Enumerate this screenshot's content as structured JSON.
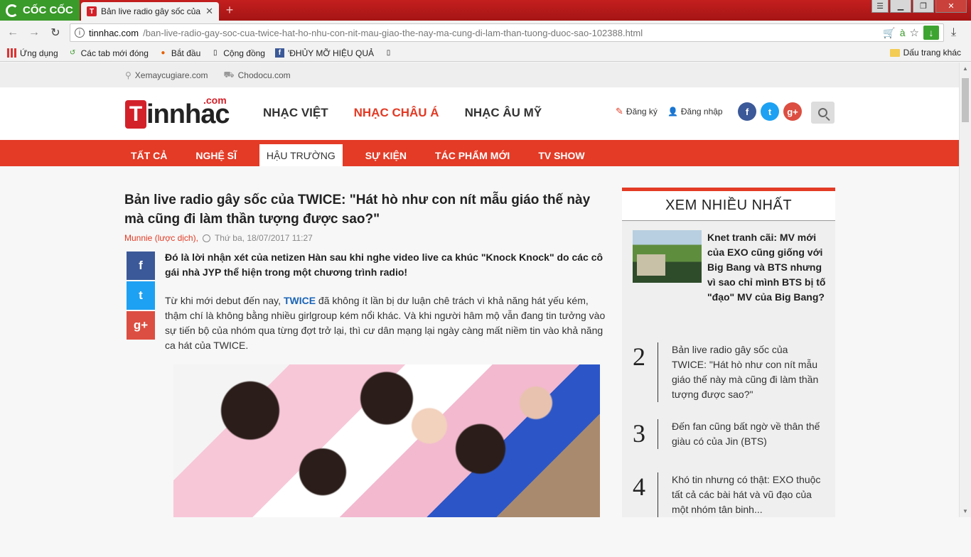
{
  "browser": {
    "brand": "CỐC CỐC",
    "tab_title": "Bản live radio gây sốc của",
    "tab_favicon": "T",
    "url_host": "tinnhac.com",
    "url_path": "/ban-live-radio-gay-soc-cua-twice-hat-ho-nhu-con-nit-mau-giao-the-nay-ma-cung-di-lam-than-tuong-duoc-sao-102388.html",
    "bookmarks": [
      "Ứng dụng",
      "Các tab mới đóng",
      "Bắt đầu",
      "Cộng đồng",
      "'ĐHỦY MỠ HIỆU QUẢ"
    ],
    "other_bookmarks": "Dấu trang khác"
  },
  "site": {
    "top_links": [
      "Xemaycugiare.com",
      "Chodocu.com"
    ],
    "logo": {
      "letter": "T",
      "text": "innhac",
      "com": ".com"
    },
    "main_nav": [
      "NHẠC VIỆT",
      "NHẠC CHÂU Á",
      "NHẠC ÂU MỸ"
    ],
    "auth": {
      "register": "Đăng ký",
      "login": "Đăng nhập"
    },
    "social": {
      "facebook": "f",
      "twitter": "t",
      "googleplus": "g+"
    },
    "sub_nav": [
      "TẤT CẢ",
      "NGHỆ SĨ",
      "HẬU TRƯỜNG",
      "SỰ KIỆN",
      "TÁC PHẨM MỚI",
      "TV SHOW"
    ]
  },
  "article": {
    "title": "Bản live radio gây sốc của TWICE: \"Hát hò như con nít mẫu giáo thế này mà cũng đi làm thần tượng được sao?\"",
    "author": "Munnie (lược dịch),",
    "date": "Thứ ba, 18/07/2017 11:27",
    "lead": "Đó là lời nhận xét của netizen Hàn sau khi nghe video live ca khúc \"Knock Knock\" do các cô gái nhà JYP thể hiện trong một chương trình radio!",
    "para_pre": "Từ khi mới debut đến nay, ",
    "para_tag": "TWICE",
    "para_post": " đã không ít lần bị dư luận chê trách vì khả năng hát yếu kém, thậm chí là không bằng nhiều girlgroup kém nổi khác. Và khi người hâm mộ vẫn đang tin tưởng vào sự tiến bộ của nhóm qua từng đợt trở lại, thì cư dân mạng lại ngày càng mất niềm tin vào khả năng ca hát của TWICE."
  },
  "sidebar": {
    "heading": "XEM NHIỀU NHẤT",
    "feature_title": "Knet tranh cãi: MV mới của EXO cũng giống với Big Bang và BTS nhưng vì sao chỉ mình BTS bị tố \"đạo\" MV của Big Bang?",
    "items": [
      {
        "num": "2",
        "text": "Bản live radio gây sốc của TWICE: \"Hát hò như con nít mẫu giáo thế này mà cũng đi làm thần tượng được sao?\""
      },
      {
        "num": "3",
        "text": "Đến fan cũng bất ngờ về thân thế giàu có của Jin (BTS)"
      },
      {
        "num": "4",
        "text": "Khó tin nhưng có thật: EXO thuộc tất cả các bài hát và vũ đạo của một nhóm tân binh..."
      }
    ]
  }
}
